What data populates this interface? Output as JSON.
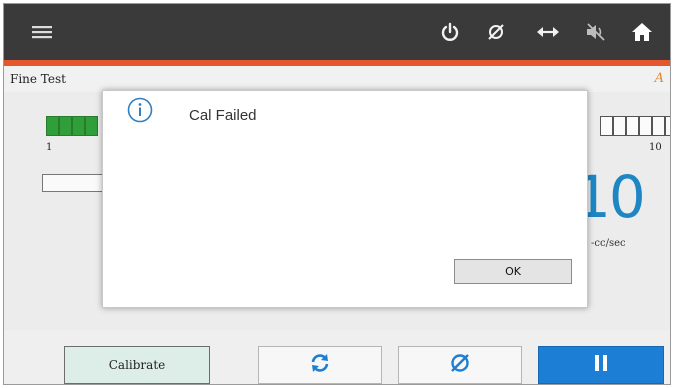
{
  "colors": {
    "topbar": "#3a3a3a",
    "accent": "#e4572e",
    "reading": "#1e86c3",
    "bar_on": "#2f9f3a",
    "pause_bg": "#1c7ed4"
  },
  "topbar": {
    "icons": [
      "menu-icon",
      "power-icon",
      "null-icon",
      "swap-arrows-icon",
      "mute-icon",
      "home-icon"
    ]
  },
  "screen": {
    "title": "Fine Test",
    "warning_glyph": "A"
  },
  "gauge": {
    "segments_total": 10,
    "segments_filled": 4,
    "scale_min": "1",
    "scale_max": "10",
    "reading": "10",
    "unit": "-cc/sec"
  },
  "dialog": {
    "icon": "info-icon",
    "message": "Cal Failed",
    "ok_label": "OK"
  },
  "bottom": {
    "calibrate_label": "Calibrate",
    "refresh_icon": "refresh-icon",
    "zero_icon": "null-icon",
    "pause_icon": "pause-icon"
  }
}
